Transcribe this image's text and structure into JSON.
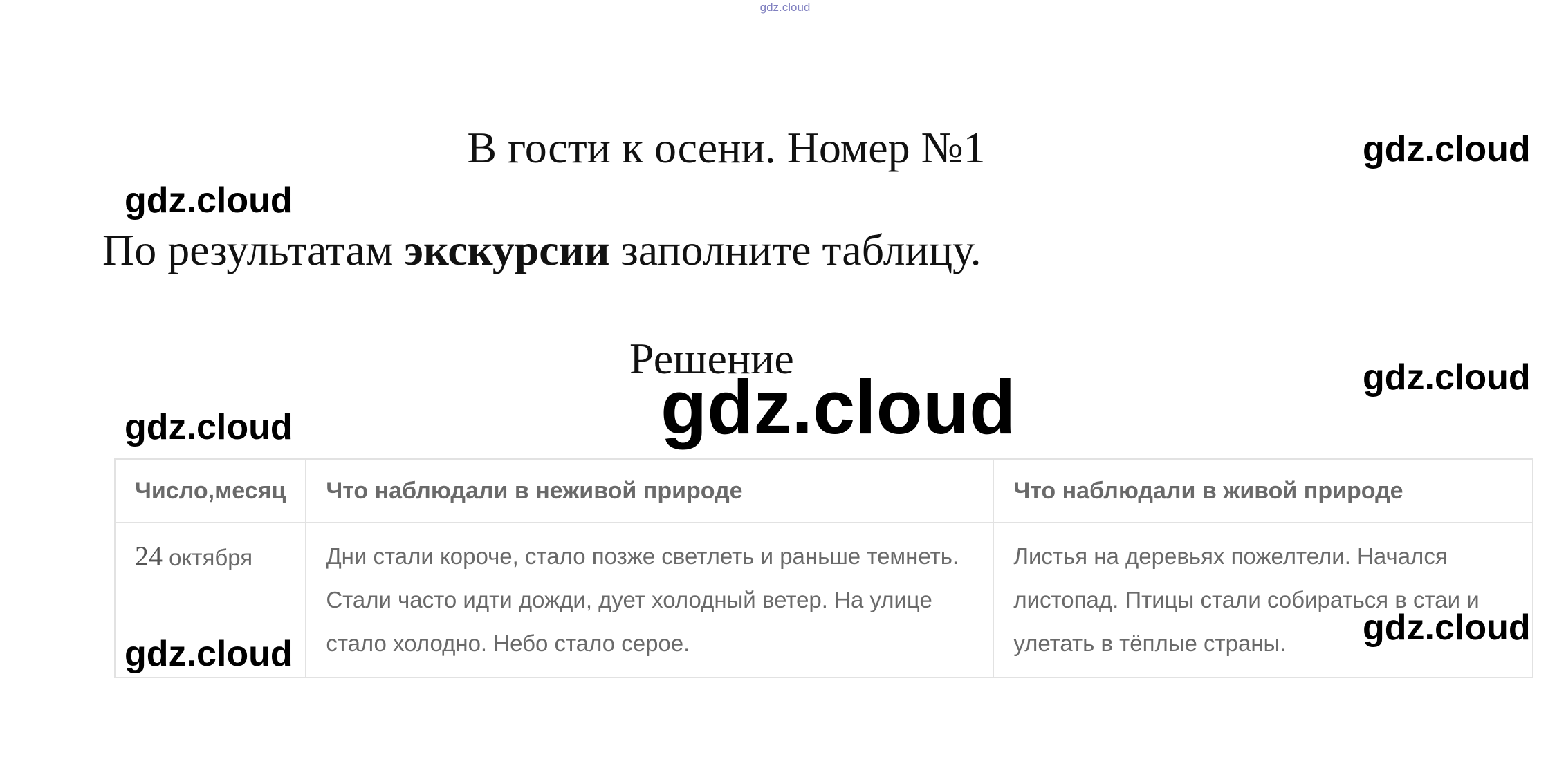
{
  "header_link": "gdz.cloud",
  "title": "В гости к осени. Номер №1",
  "task": {
    "before": "По результатам ",
    "bold": "экскурсии",
    "after": " заполните таблицу."
  },
  "solution_label": "Решение",
  "watermarks": {
    "w1": "gdz.cloud",
    "w2": "gdz.cloud",
    "w3": "gdz.cloud",
    "w4": "gdz.cloud",
    "w5": "gdz.cloud",
    "w6": "gdz.cloud",
    "big": "gdz.cloud"
  },
  "table": {
    "headers": [
      "Число,месяц",
      "Что наблюдали в неживой природе",
      "Что наблюдали в живой природе"
    ],
    "row": {
      "day": "24",
      "month": " октября",
      "nonliving": "Дни стали короче, стало позже светлеть и раньше темнеть. Стали часто идти дожди, дует холодный ветер. На улице стало холодно. Небо стало серое.",
      "living": "Листья на деревьях пожелтели. Начался листопад. Птицы стали собираться в стаи и улетать в тёплые страны."
    }
  }
}
